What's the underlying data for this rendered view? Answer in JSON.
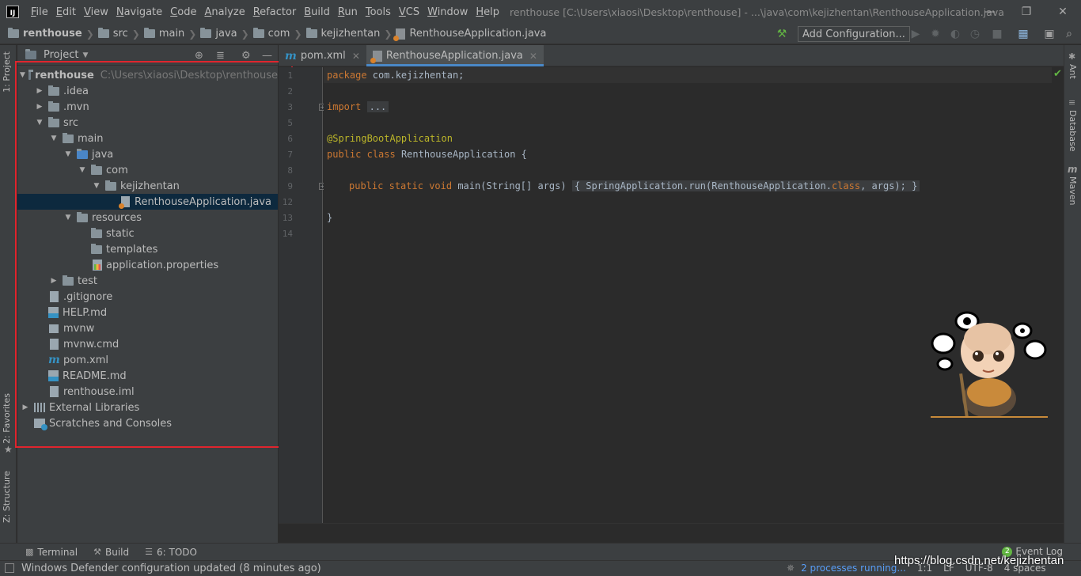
{
  "menubar": {
    "items": [
      "File",
      "Edit",
      "View",
      "Navigate",
      "Code",
      "Analyze",
      "Refactor",
      "Build",
      "Run",
      "Tools",
      "VCS",
      "Window",
      "Help"
    ],
    "window_title": "renthouse [C:\\Users\\xiaosi\\Desktop\\renthouse] - ...\\java\\com\\kejizhentan\\RenthouseApplication.java"
  },
  "navbar": {
    "crumbs": [
      "renthouse",
      "src",
      "main",
      "java",
      "com",
      "kejizhentan",
      "RenthouseApplication.java"
    ],
    "add_configuration": "Add Configuration..."
  },
  "left_strip": {
    "project_tab": "1: Project",
    "favorites_tab": "2: Favorites",
    "structure_tab": "Z: Structure"
  },
  "right_strip": {
    "ant_tab": "Ant",
    "database_tab": "Database",
    "maven_tab": "Maven"
  },
  "project_panel": {
    "title": "Project",
    "root_path": "C:\\Users\\xiaosi\\Desktop\\renthouse",
    "tree": [
      {
        "label": "renthouse",
        "icon": "folder",
        "arrow": "open"
      },
      {
        "label": ".idea",
        "icon": "folder",
        "arrow": "closed"
      },
      {
        "label": ".mvn",
        "icon": "folder",
        "arrow": "closed"
      },
      {
        "label": "src",
        "icon": "folder",
        "arrow": "open"
      },
      {
        "label": "main",
        "icon": "folder",
        "arrow": "open"
      },
      {
        "label": "java",
        "icon": "folder",
        "arrow": "open"
      },
      {
        "label": "com",
        "icon": "folder",
        "arrow": "open"
      },
      {
        "label": "kejizhentan",
        "icon": "folder",
        "arrow": "open"
      },
      {
        "label": "RenthouseApplication.java",
        "icon": "java",
        "arrow": "none"
      },
      {
        "label": "resources",
        "icon": "folder",
        "arrow": "open"
      },
      {
        "label": "static",
        "icon": "folder",
        "arrow": "none"
      },
      {
        "label": "templates",
        "icon": "folder",
        "arrow": "none"
      },
      {
        "label": "application.properties",
        "icon": "properties",
        "arrow": "none"
      },
      {
        "label": "test",
        "icon": "folder",
        "arrow": "closed"
      },
      {
        "label": ".gitignore",
        "icon": "file",
        "arrow": "none"
      },
      {
        "label": "HELP.md",
        "icon": "markdown",
        "arrow": "none"
      },
      {
        "label": "mvnw",
        "icon": "executable",
        "arrow": "none"
      },
      {
        "label": "mvnw.cmd",
        "icon": "file",
        "arrow": "none"
      },
      {
        "label": "pom.xml",
        "icon": "maven",
        "arrow": "none"
      },
      {
        "label": "README.md",
        "icon": "markdown",
        "arrow": "none"
      },
      {
        "label": "renthouse.iml",
        "icon": "file",
        "arrow": "none"
      },
      {
        "label": "External Libraries",
        "icon": "library",
        "arrow": "closed"
      },
      {
        "label": "Scratches and Consoles",
        "icon": "scratch",
        "arrow": "none"
      }
    ]
  },
  "editor": {
    "tabs": [
      {
        "label": "pom.xml",
        "active": false
      },
      {
        "label": "RenthouseApplication.java",
        "active": true
      }
    ],
    "line_numbers": [
      "1",
      "2",
      "3",
      "5",
      "6",
      "7",
      "8",
      "9",
      "12",
      "13",
      "14"
    ],
    "code": {
      "package_kw": "package",
      "package_name": " com.kejizhentan;",
      "import_kw": "import",
      "import_fold": "...",
      "annotation": "@SpringBootApplication",
      "public_kw": "public",
      "class_kw": "class",
      "class_name": " RenthouseApplication {",
      "main_public": "public",
      "main_static": "static",
      "main_void": "void",
      "main_sig": " main(String[] args)",
      "body_open": "{",
      "body_call": " SpringApplication.run(RenthouseApplication.",
      "body_class_kw": "class",
      "body_args": ", args);",
      "body_close": "}",
      "close_brace": "}"
    }
  },
  "bottom_tools": {
    "terminal": "Terminal",
    "build": "Build",
    "todo": "6: TODO",
    "event_log": "Event Log",
    "event_count": "2"
  },
  "statusbar": {
    "message": "Windows Defender configuration updated (8 minutes ago)",
    "processes": "2 processes running...",
    "position": "1:1",
    "line_sep": "LF",
    "encoding": "UTF-8",
    "indent": "4 spaces"
  },
  "watermark": "https://blog.csdn.net/kejizhentan"
}
